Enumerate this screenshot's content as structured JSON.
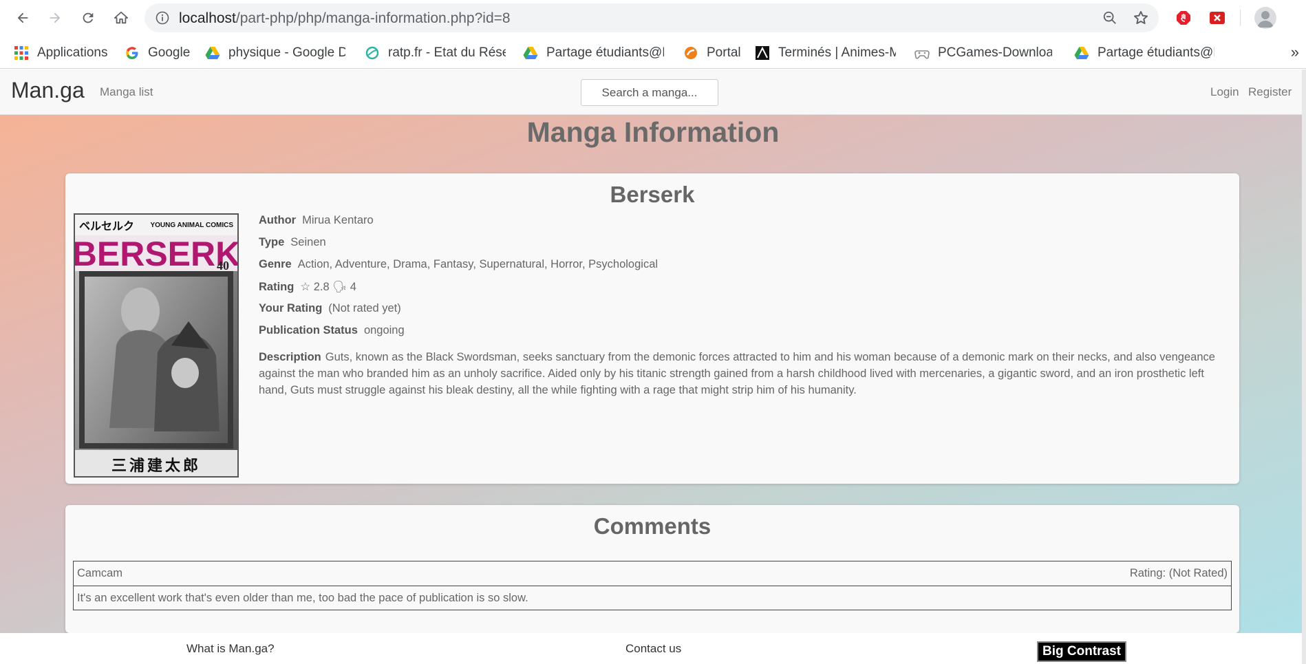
{
  "browser": {
    "url_host": "localhost",
    "url_path": "/part-php/php/manga-information.php?id=8"
  },
  "bookmarks": [
    {
      "label": "Applications",
      "icon": "apps-grid-icon"
    },
    {
      "label": "Google",
      "icon": "google-icon"
    },
    {
      "label": "physique - Google Dr",
      "icon": "google-drive-icon"
    },
    {
      "label": "ratp.fr - Etat du Résea",
      "icon": "ratp-icon"
    },
    {
      "label": "Partage étudiants@EF",
      "icon": "google-drive-icon"
    },
    {
      "label": "Portal",
      "icon": "portal-icon"
    },
    {
      "label": "Terminés | Animes-M",
      "icon": "anime-icon"
    },
    {
      "label": "PCGames-Download",
      "icon": "gamepad-icon"
    },
    {
      "label": "Partage étudiants@EF",
      "icon": "google-drive-icon"
    }
  ],
  "navbar": {
    "brand": "Man.ga",
    "manga_list": "Manga list",
    "search_placeholder": "Search a manga...",
    "login": "Login",
    "register": "Register"
  },
  "page": {
    "title": "Manga Information"
  },
  "manga": {
    "title": "Berserk",
    "fields": {
      "author_label": "Author",
      "author": "Mirua Kentaro",
      "type_label": "Type",
      "type": "Seinen",
      "genre_label": "Genre",
      "genre": "Action, Adventure, Drama, Fantasy, Supernatural, Horror, Psychological",
      "rating_label": "Rating",
      "rating": "☆ 2.8 🗣 4",
      "your_rating_label": "Your Rating",
      "your_rating": "(Not rated yet)",
      "status_label": "Publication Status",
      "status": "ongoing",
      "description_label": "Description",
      "description": "Guts, known as the Black Swordsman, seeks sanctuary from the demonic forces attracted to him and his woman because of a demonic mark on their necks, and also vengeance against the man who branded him as an unholy sacrifice. Aided only by his titanic strength gained from a harsh childhood lived with mercenaries, a gigantic sword, and an iron prosthetic left hand, Guts must struggle against his bleak destiny, all the while fighting with a rage that might strip him of his humanity."
    },
    "cover": {
      "kana_title": "ベルセルク",
      "publisher": "YOUNG ANIMAL COMICS",
      "logo": "BERSERK",
      "volume": "40",
      "author_kanji": "三浦建太郎"
    }
  },
  "comments": {
    "title": "Comments",
    "items": [
      {
        "user": "Camcam",
        "rating": "Rating: (Not Rated)",
        "text": "It's an excellent work that's even older than me, too bad the pace of publication is so slow."
      }
    ]
  },
  "footer": {
    "what_is": "What is Man.ga?",
    "contact": "Contact us",
    "big_contrast": "Big Contrast"
  }
}
